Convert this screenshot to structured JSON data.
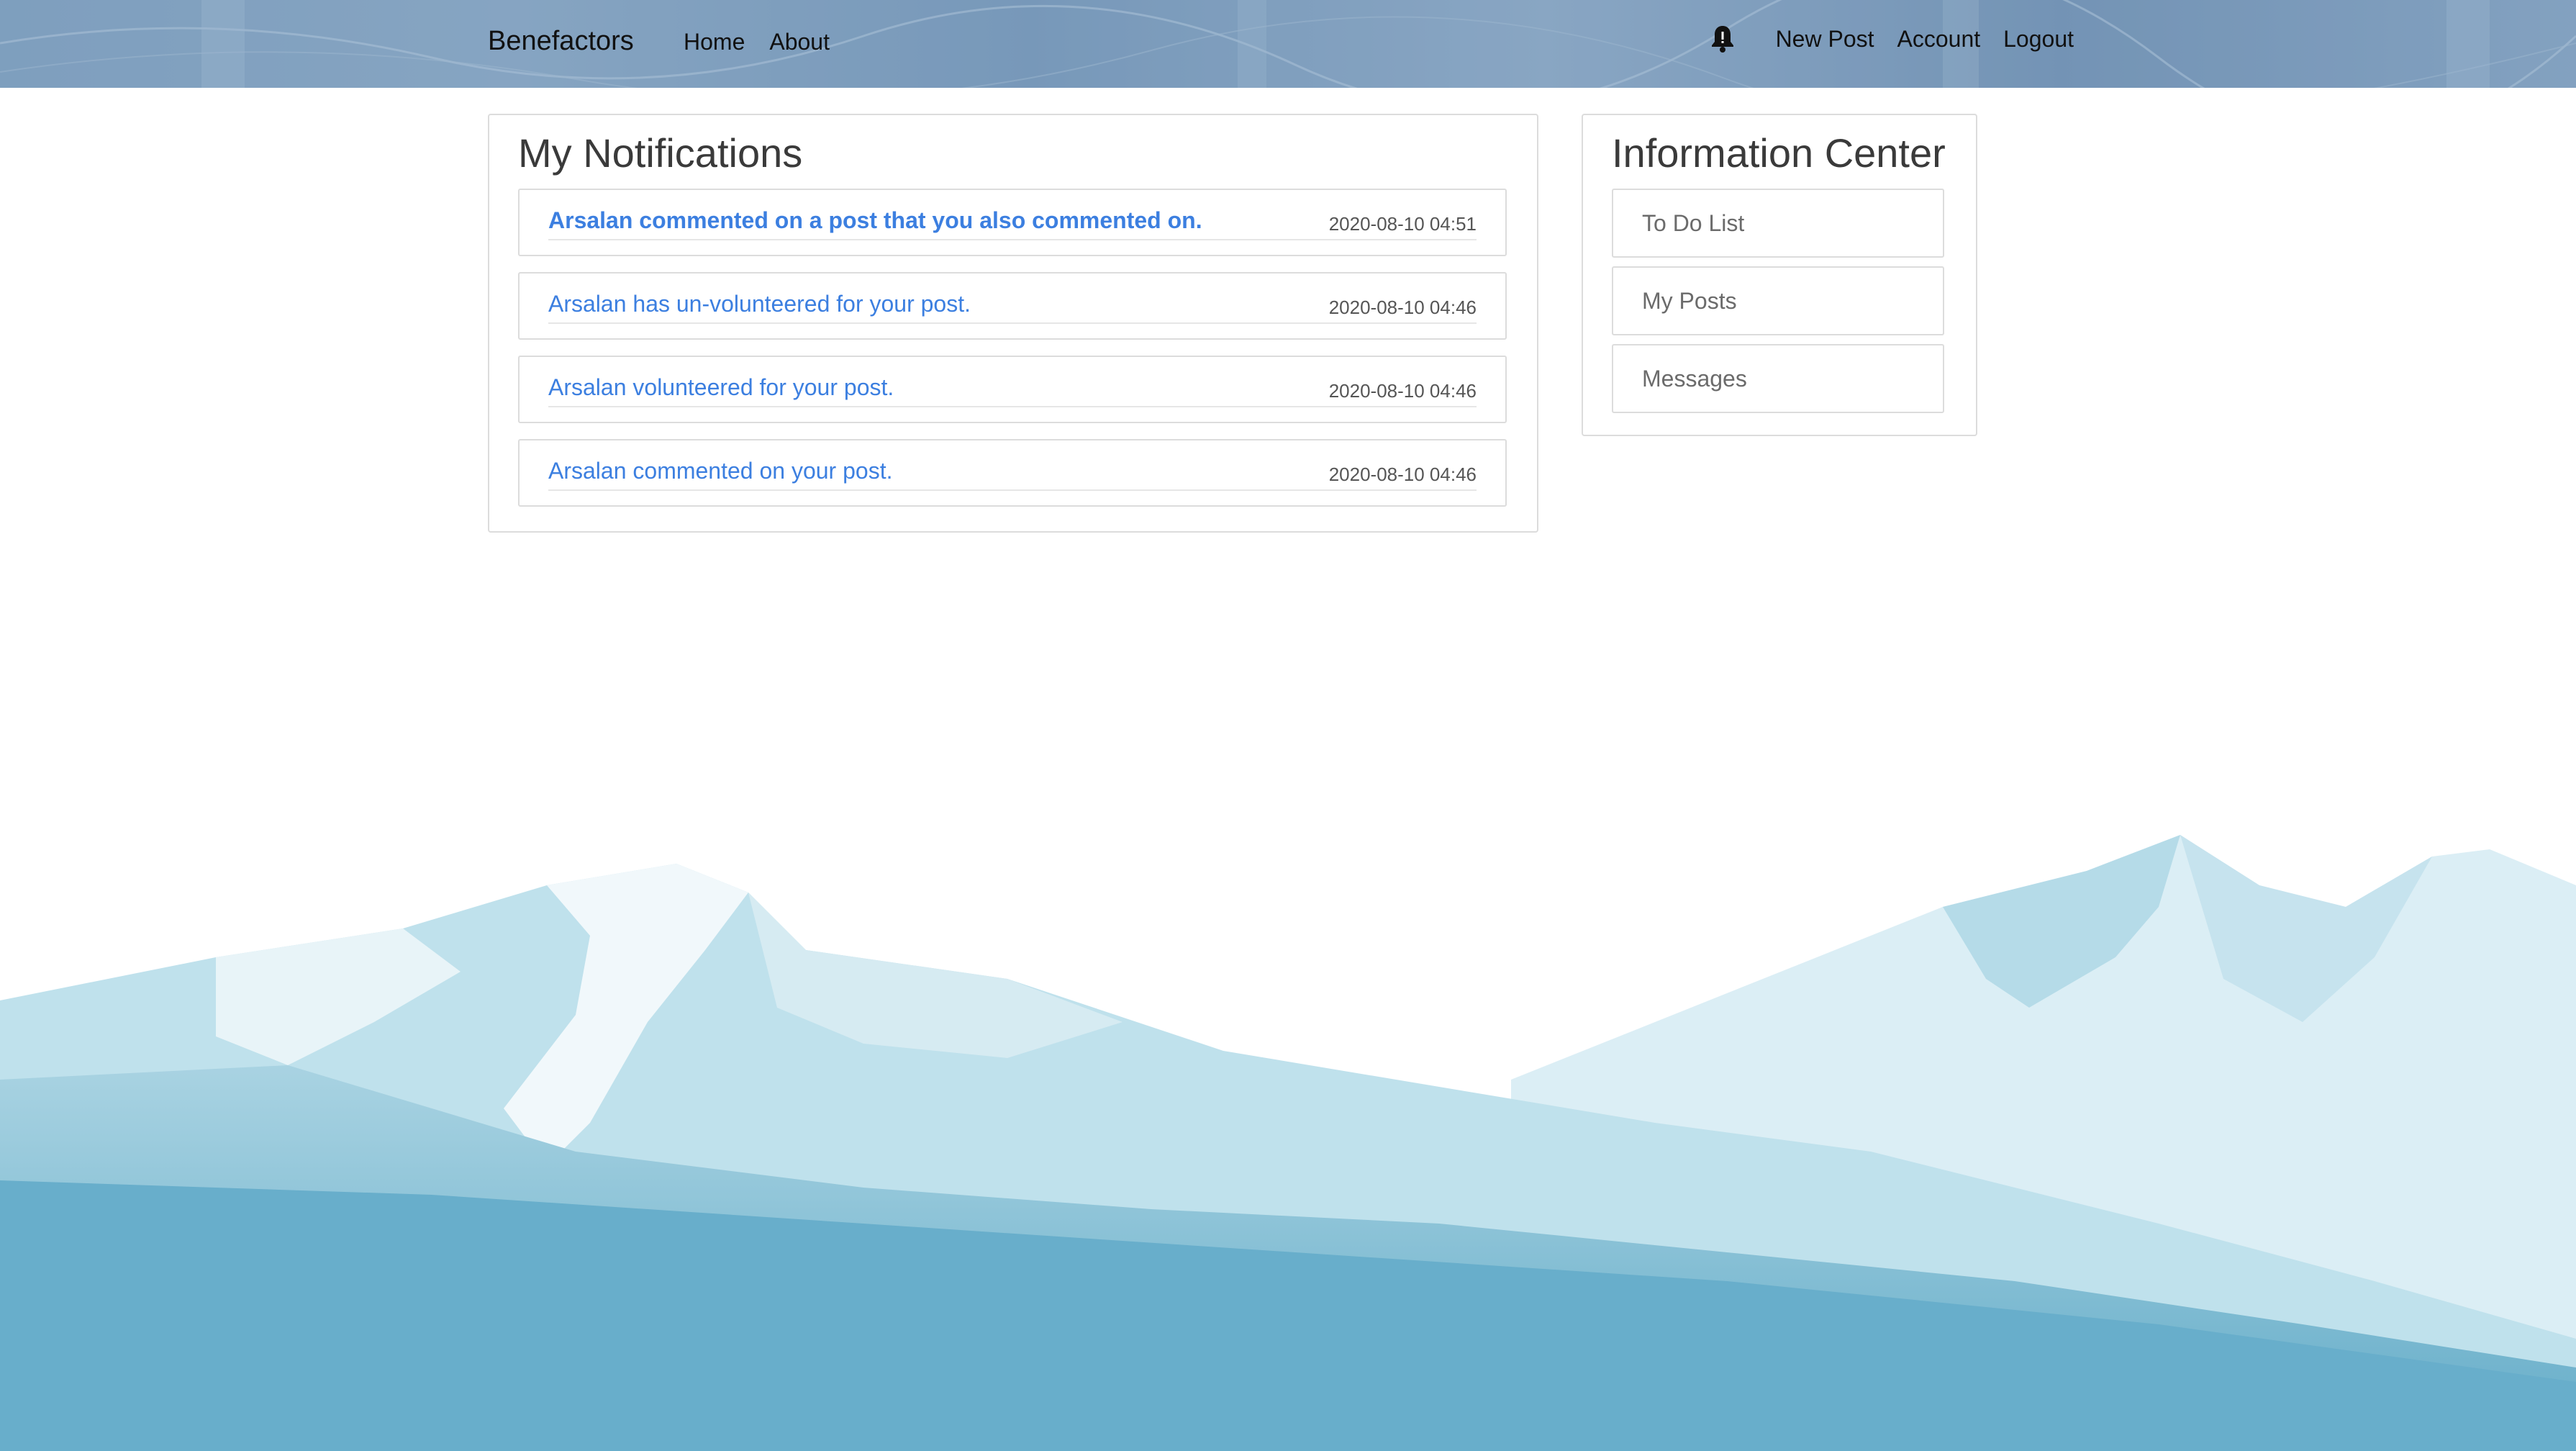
{
  "navbar": {
    "brand": "Benefactors",
    "left_links": [
      "Home",
      "About"
    ],
    "right_links": [
      "New Post",
      "Account",
      "Logout"
    ],
    "bell_icon": "bell-icon"
  },
  "notifications": {
    "title": "My Notifications",
    "items": [
      {
        "text": "Arsalan commented on a post that you also commented on.",
        "time": "2020-08-10 04:51",
        "unread": true
      },
      {
        "text": "Arsalan has un-volunteered for your post.",
        "time": "2020-08-10 04:46",
        "unread": false
      },
      {
        "text": "Arsalan volunteered for your post.",
        "time": "2020-08-10 04:46",
        "unread": false
      },
      {
        "text": "Arsalan commented on your post.",
        "time": "2020-08-10 04:46",
        "unread": false
      }
    ]
  },
  "info_center": {
    "title": "Information Center",
    "items": [
      "To Do List",
      "My Posts",
      "Messages"
    ]
  },
  "colors": {
    "link": "#3c7fe0",
    "navbar": "#7f9fbf",
    "mountain_dark": "#6aafc9",
    "mountain_light": "#b9dde8"
  }
}
